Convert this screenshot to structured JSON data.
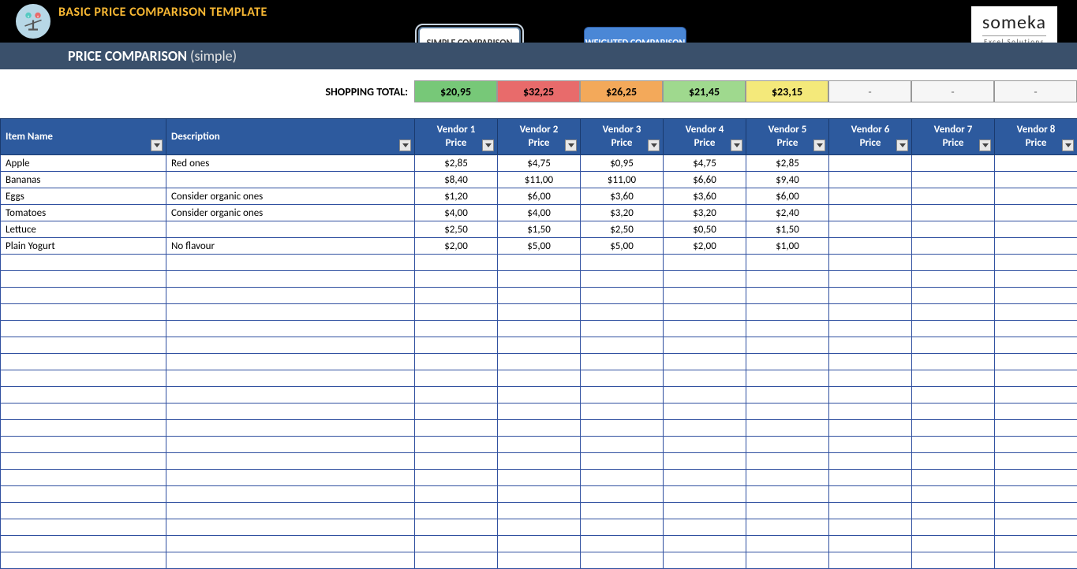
{
  "banner": {
    "title": "BASIC PRICE COMPARISON TEMPLATE",
    "subtitle_bold": "PRICE COMPARISON",
    "subtitle_paren": "(simple)"
  },
  "tabs": {
    "simple": "SIMPLE COMPARISON",
    "weighted": "WEIGHTED COMPARISON"
  },
  "brand": {
    "name": "someka",
    "tag": "Excel Solutions"
  },
  "totals": {
    "label": "SHOPPING TOTAL:",
    "cells": [
      {
        "value": "$20,95",
        "cls": "c-green"
      },
      {
        "value": "$32,25",
        "cls": "c-red"
      },
      {
        "value": "$26,25",
        "cls": "c-orange"
      },
      {
        "value": "$21,45",
        "cls": "c-lgreen"
      },
      {
        "value": "$23,15",
        "cls": "c-yellow"
      },
      {
        "value": "-",
        "cls": "c-grey"
      },
      {
        "value": "-",
        "cls": "c-grey"
      },
      {
        "value": "-",
        "cls": "c-grey"
      }
    ]
  },
  "headers": {
    "item": "Item Name",
    "desc": "Description",
    "vendors": [
      "Vendor 1 Price",
      "Vendor 2 Price",
      "Vendor 3 Price",
      "Vendor 4 Price",
      "Vendor 5 Price",
      "Vendor 6 Price",
      "Vendor 7 Price",
      "Vendor 8 Price"
    ]
  },
  "rows": [
    {
      "item": "Apple",
      "desc": "Red ones",
      "p": [
        "$2,85",
        "$4,75",
        "$0,95",
        "$4,75",
        "$2,85",
        "",
        "",
        ""
      ]
    },
    {
      "item": "Bananas",
      "desc": "",
      "p": [
        "$8,40",
        "$11,00",
        "$11,00",
        "$6,60",
        "$9,40",
        "",
        "",
        ""
      ]
    },
    {
      "item": "Eggs",
      "desc": "Consider organic ones",
      "p": [
        "$1,20",
        "$6,00",
        "$3,60",
        "$3,60",
        "$6,00",
        "",
        "",
        ""
      ]
    },
    {
      "item": "Tomatoes",
      "desc": "Consider organic ones",
      "p": [
        "$4,00",
        "$4,00",
        "$3,20",
        "$3,20",
        "$2,40",
        "",
        "",
        ""
      ]
    },
    {
      "item": "Lettuce",
      "desc": "",
      "p": [
        "$2,50",
        "$1,50",
        "$2,50",
        "$0,50",
        "$1,50",
        "",
        "",
        ""
      ]
    },
    {
      "item": "Plain Yogurt",
      "desc": "No flavour",
      "p": [
        "$2,00",
        "$5,00",
        "$5,00",
        "$2,00",
        "$1,00",
        "",
        "",
        ""
      ]
    }
  ],
  "empty_rows": 19
}
